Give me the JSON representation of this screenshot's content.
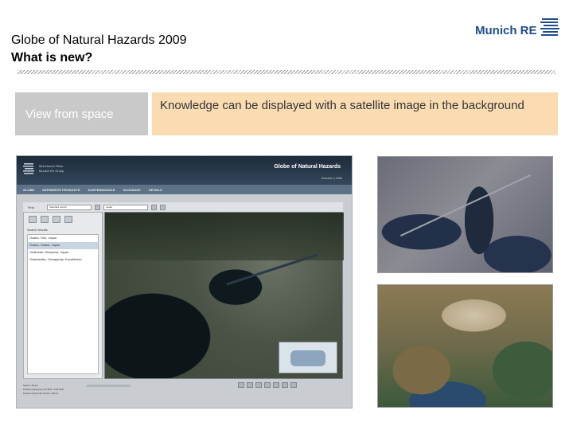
{
  "slide": {
    "title_line1": "Globe of Natural Hazards 2009",
    "title_line2": "What is new?",
    "logo_text": "Munich RE",
    "label": "View from space",
    "description": "Knowledge can be displayed with a satellite image in the background"
  },
  "app": {
    "logo_text_1": "Münchener Rück",
    "logo_text_2": "Munich Re Group",
    "title": "Globe of Natural Hazards",
    "links": "Drucken  |  Hilfe",
    "nav": [
      "GLOBE",
      "DEFINIERTE PRODUKTE",
      "KARTENMODULE",
      "GLOSSARY",
      "DETAILS"
    ],
    "find_label": "Find",
    "find_input": "Standard search",
    "find_value": "osaka",
    "results_heading": "Search results",
    "results": [
      "Osaka, Gifu, Japan",
      "Osaka, Osaka, Japan",
      "Osakadai, Okayama, Japan",
      "Osakasaiko, Garagandy, Kazakhstan"
    ],
    "status_lines": [
      "Scale          1:25 km",
      "Position (Degrees)   34°38'N / 135°12'E",
      "Position (Decimal)   34.63 / 135.21"
    ]
  },
  "colors": {
    "brand_blue": "#1e4d8c",
    "label_gray": "#c9c9c9",
    "desc_orange": "#fbdcb2"
  }
}
